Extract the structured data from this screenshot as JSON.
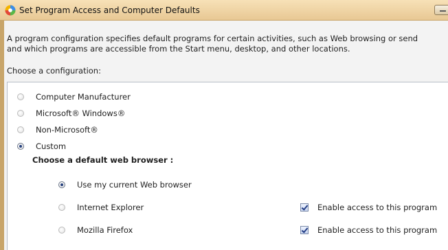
{
  "window": {
    "title": "Set Program Access and Computer Defaults",
    "icon": "program-defaults-icon"
  },
  "description": {
    "line1": "A program configuration specifies default programs for certain activities, such as Web browsing or send",
    "line2": "and which programs are accessible from the Start menu, desktop, and other locations."
  },
  "configuration": {
    "label": "Choose a configuration:",
    "options": [
      {
        "label": "Computer Manufacturer",
        "selected": false
      },
      {
        "label": "Microsoft® Windows®",
        "selected": false
      },
      {
        "label": "Non-Microsoft®",
        "selected": false
      },
      {
        "label": "Custom",
        "selected": true
      }
    ]
  },
  "browser": {
    "heading": "Choose a default web browser :",
    "options": [
      {
        "label": "Use my current Web browser",
        "selected": true
      },
      {
        "label": "Internet Explorer",
        "selected": false,
        "access_label": "Enable access to this program",
        "access_checked": true
      },
      {
        "label": "Mozilla Firefox",
        "selected": false,
        "access_label": "Enable access to this program",
        "access_checked": true
      }
    ]
  }
}
